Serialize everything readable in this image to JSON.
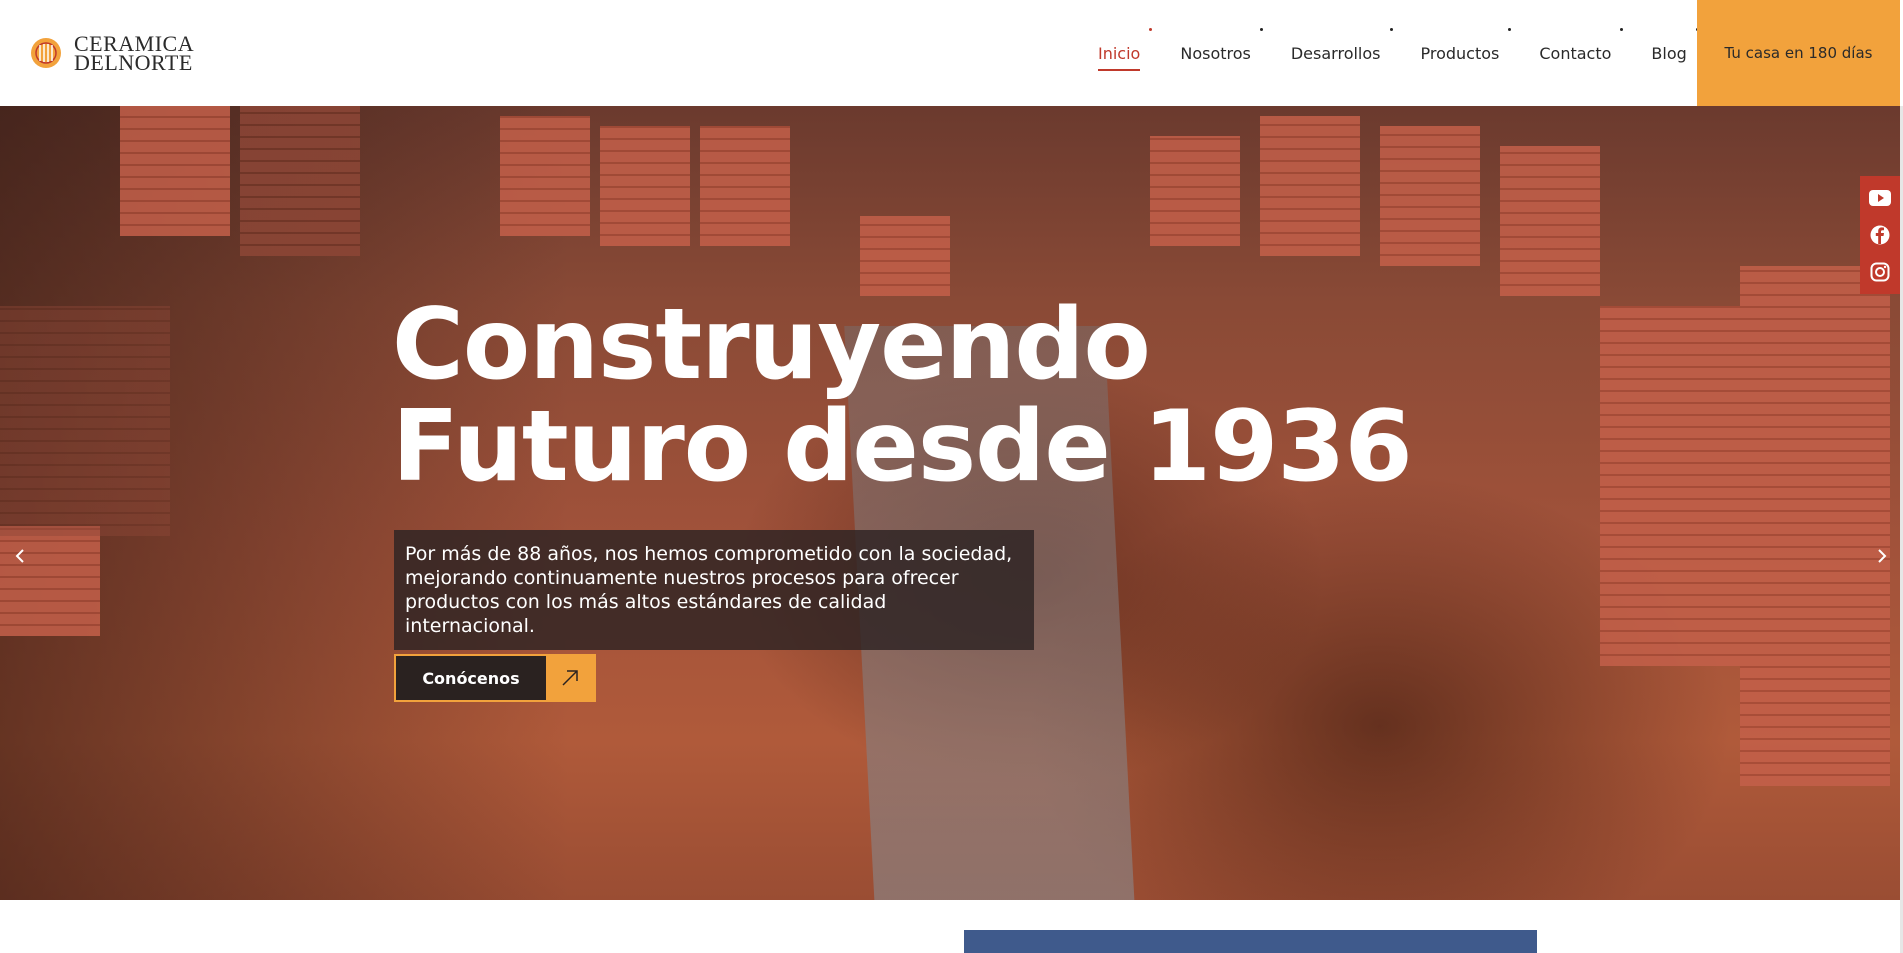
{
  "brand": {
    "line1": "CERAMICA",
    "line2": "DELNORTE"
  },
  "nav": {
    "items": [
      {
        "label": "Inicio",
        "active": true
      },
      {
        "label": "Nosotros",
        "active": false
      },
      {
        "label": "Desarrollos",
        "active": false
      },
      {
        "label": "Productos",
        "active": false
      },
      {
        "label": "Contacto",
        "active": false
      },
      {
        "label": "Blog",
        "active": false
      }
    ],
    "cta_label": "Tu casa en 180 días"
  },
  "hero": {
    "title_line1": "Construyendo",
    "title_line2": "Futuro desde 1936",
    "description": "Por más de 88 años, nos hemos comprometido con la sociedad, mejorando continuamente nuestros procesos para ofrecer productos con los más altos estándares de calidad internacional.",
    "button_label": "Conócenos"
  },
  "social": [
    "youtube-icon",
    "facebook-icon",
    "instagram-icon"
  ],
  "colors": {
    "accent": "#f2a23c",
    "active_nav": "#c0392b",
    "social_bg": "#c0392b",
    "button_dark": "#2a2220"
  }
}
